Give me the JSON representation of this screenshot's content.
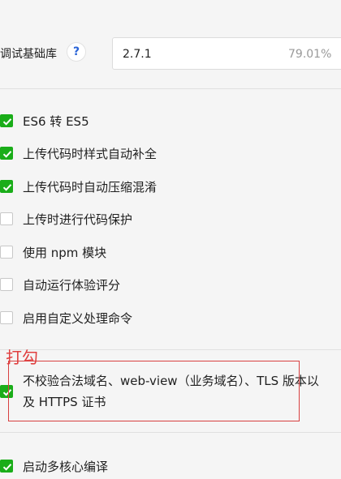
{
  "debug": {
    "label": "调试基础库",
    "help_symbol": "?",
    "version": "2.7.1",
    "coverage": "79.01%"
  },
  "options": {
    "es6": {
      "label": "ES6 转 ES5",
      "checked": true
    },
    "style_complete": {
      "label": "上传代码时样式自动补全",
      "checked": true
    },
    "minify": {
      "label": "上传代码时自动压缩混淆",
      "checked": true
    },
    "protect": {
      "label": "上传时进行代码保护",
      "checked": false
    },
    "npm": {
      "label": "使用 npm 模块",
      "checked": false
    },
    "score": {
      "label": "自动运行体验评分",
      "checked": false
    },
    "custom_cmd": {
      "label": "启用自定义处理命令",
      "checked": false
    },
    "no_domain_check": {
      "label": "不校验合法域名、web-view（业务域名）、TLS 版本以及 HTTPS 证书",
      "checked": true
    },
    "multicore": {
      "label": "启动多核心编译",
      "checked": true
    }
  },
  "annotation": {
    "text": "打勾"
  },
  "colors": {
    "check_green": "#1aad19",
    "annotation_red": "#d84040",
    "help_blue": "#2a64d7"
  }
}
